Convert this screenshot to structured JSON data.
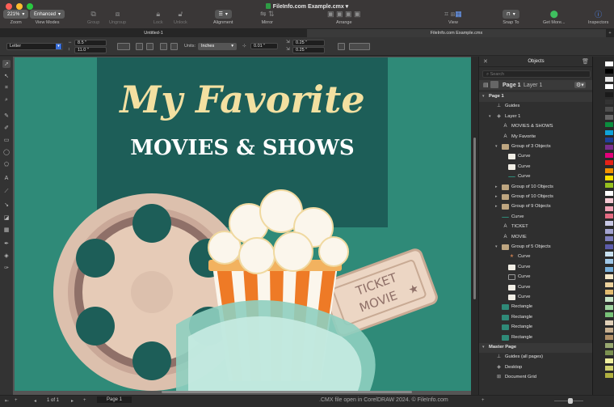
{
  "window": {
    "title": "FileInfo.com Example.cmx",
    "zoom": "221%",
    "view_mode": "Enhanced",
    "traffic_colors": [
      "#fe5f57",
      "#febc2e",
      "#28c840"
    ]
  },
  "toolbar": {
    "zoom_label": "Zoom",
    "view_modes_label": "View Modes",
    "group_label": "Group",
    "ungroup_label": "Ungroup",
    "lock_label": "Lock",
    "unlock_label": "Unlock",
    "alignment_label": "Alignment",
    "mirror_label": "Mirror",
    "arrange_label": "Arrange",
    "view_label": "View",
    "snap_to_label": "Snap To",
    "get_more_label": "Get More...",
    "inspectors_label": "Inspectors"
  },
  "tabs": [
    "Untitled-1",
    "FileInfo.com Example.cmx"
  ],
  "properties": {
    "page_size": "Letter",
    "width": "8.5 \"",
    "height": "11.0 \"",
    "units_label": "Units:",
    "units": "Inches",
    "nudge": "0.01 \"",
    "dup_x": "0.25 \"",
    "dup_y": "0.25 \""
  },
  "artwork": {
    "title_line1": "My Favorite",
    "title_line2": "MOVIES & SHOWS",
    "ticket_line1": "TICKET",
    "ticket_line2": "MOVIE",
    "colors": {
      "bg": "#2f8a78",
      "panel": "#1d5e58",
      "cream": "#f3e0a1",
      "reel": "#dcc0ad",
      "reel_dark": "#8f7068",
      "orange": "#ee7a26",
      "popcorn": "#fbf6ec"
    }
  },
  "status": {
    "page_of": "1  of  1",
    "page_tab": "Page 1",
    "caption": ".CMX file open in CorelDRAW 2024. © FileInfo.com"
  },
  "objects_panel": {
    "title": "Objects",
    "search_placeholder": "Search",
    "page_name": "Page 1",
    "layer_name": "Layer 1",
    "rows": [
      {
        "label": "Page 1",
        "indent": 0,
        "arrow": "▾",
        "icon": "none",
        "header": true
      },
      {
        "label": "Guides",
        "indent": 1,
        "arrow": "",
        "icon": "guides"
      },
      {
        "label": "Layer 1",
        "indent": 1,
        "arrow": "▾",
        "icon": "layer"
      },
      {
        "label": "MOVIES & SHOWS",
        "indent": 2,
        "arrow": "",
        "icon": "text"
      },
      {
        "label": "My Favorite",
        "indent": 2,
        "arrow": "",
        "icon": "text"
      },
      {
        "label": "Group of 3 Objects",
        "indent": 2,
        "arrow": "▾",
        "icon": "group"
      },
      {
        "label": "Curve",
        "indent": 3,
        "arrow": "",
        "icon": "curve-white"
      },
      {
        "label": "Curve",
        "indent": 3,
        "arrow": "",
        "icon": "curve-white"
      },
      {
        "label": "Curve",
        "indent": 3,
        "arrow": "",
        "icon": "curve-line"
      },
      {
        "label": "Group of 10 Objects",
        "indent": 2,
        "arrow": "▸",
        "icon": "group"
      },
      {
        "label": "Group of 10 Objects",
        "indent": 2,
        "arrow": "▸",
        "icon": "group"
      },
      {
        "label": "Group of 9 Objects",
        "indent": 2,
        "arrow": "▸",
        "icon": "group"
      },
      {
        "label": "Curve",
        "indent": 2,
        "arrow": "",
        "icon": "curve-line"
      },
      {
        "label": "TICKET",
        "indent": 2,
        "arrow": "",
        "icon": "text"
      },
      {
        "label": "MOVIE",
        "indent": 2,
        "arrow": "",
        "icon": "text"
      },
      {
        "label": "Group of 5 Objects",
        "indent": 2,
        "arrow": "▾",
        "icon": "group"
      },
      {
        "label": "Curve",
        "indent": 3,
        "arrow": "",
        "icon": "star"
      },
      {
        "label": "Curve",
        "indent": 3,
        "arrow": "",
        "icon": "curve-white"
      },
      {
        "label": "Curve",
        "indent": 3,
        "arrow": "",
        "icon": "curve-outline"
      },
      {
        "label": "Curve",
        "indent": 3,
        "arrow": "",
        "icon": "curve-white"
      },
      {
        "label": "Curve",
        "indent": 3,
        "arrow": "",
        "icon": "curve-white"
      },
      {
        "label": "Rectangle",
        "indent": 2,
        "arrow": "",
        "icon": "rect"
      },
      {
        "label": "Rectangle",
        "indent": 2,
        "arrow": "",
        "icon": "rect"
      },
      {
        "label": "Rectangle",
        "indent": 2,
        "arrow": "",
        "icon": "rect"
      },
      {
        "label": "Rectangle",
        "indent": 2,
        "arrow": "",
        "icon": "rect"
      },
      {
        "label": "Master Page",
        "indent": 0,
        "arrow": "▾",
        "icon": "none",
        "header": true
      },
      {
        "label": "Guides (all pages)",
        "indent": 1,
        "arrow": "",
        "icon": "guides"
      },
      {
        "label": "Desktop",
        "indent": 1,
        "arrow": "",
        "icon": "layer"
      },
      {
        "label": "Document Grid",
        "indent": 1,
        "arrow": "",
        "icon": "grid"
      }
    ]
  },
  "palette": [
    "#ffffff",
    "#000000",
    "#e6e6e6",
    "#ffffff",
    "#1a1a1a",
    "#333333",
    "#4d4d4d",
    "#666666",
    "#0b8d3e",
    "#0fa3d9",
    "#21409a",
    "#7b2f8e",
    "#e3007a",
    "#e62117",
    "#f39200",
    "#ffde00",
    "#96c11f",
    "#ffffff",
    "#f5c9d3",
    "#f1a3b5",
    "#e46b82",
    "#c8c8e4",
    "#a4a4d1",
    "#7f7fbe",
    "#5b5bab",
    "#c8e0f0",
    "#a0c8e8",
    "#78b0dc",
    "#f5e8c8",
    "#ecd29c",
    "#e2bb70",
    "#c8e6c8",
    "#a0d4a0",
    "#78c278",
    "#e0d0b8",
    "#c8b090",
    "#b09068",
    "#98a870",
    "#7b9050",
    "#f0f0a0",
    "#d0d070",
    "#b0b040"
  ]
}
